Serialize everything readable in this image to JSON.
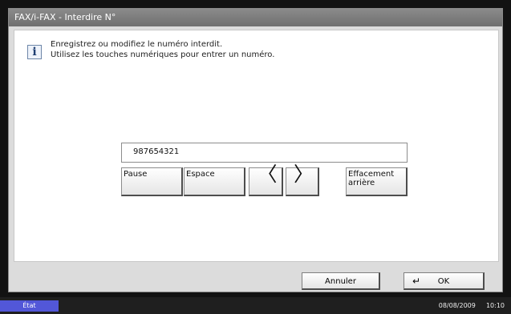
{
  "window": {
    "title": "FAX/i-FAX - Interdire N°"
  },
  "message": {
    "line1": "Enregistrez ou modifiez le numéro interdit.",
    "line2": "Utilisez les touches numériques pour entrer un numéro."
  },
  "number_field": {
    "value": "987654321"
  },
  "keypad": {
    "pause_label": "Pause",
    "space_label": "Espace",
    "backspace_line1": "Effacement",
    "backspace_line2": "arrière",
    "left_arrow": "〈",
    "right_arrow": "〉"
  },
  "footer": {
    "cancel_label": "Annuler",
    "ok_label": "OK",
    "enter_icon": "↵"
  },
  "status_bar": {
    "state_label": "État",
    "date": "08/08/2009",
    "time": "10:10"
  },
  "colors": {
    "title_bar": "#7d7d7d",
    "state_badge": "#5257d8"
  },
  "icons": {
    "info": "info-icon",
    "enter": "enter-icon"
  }
}
